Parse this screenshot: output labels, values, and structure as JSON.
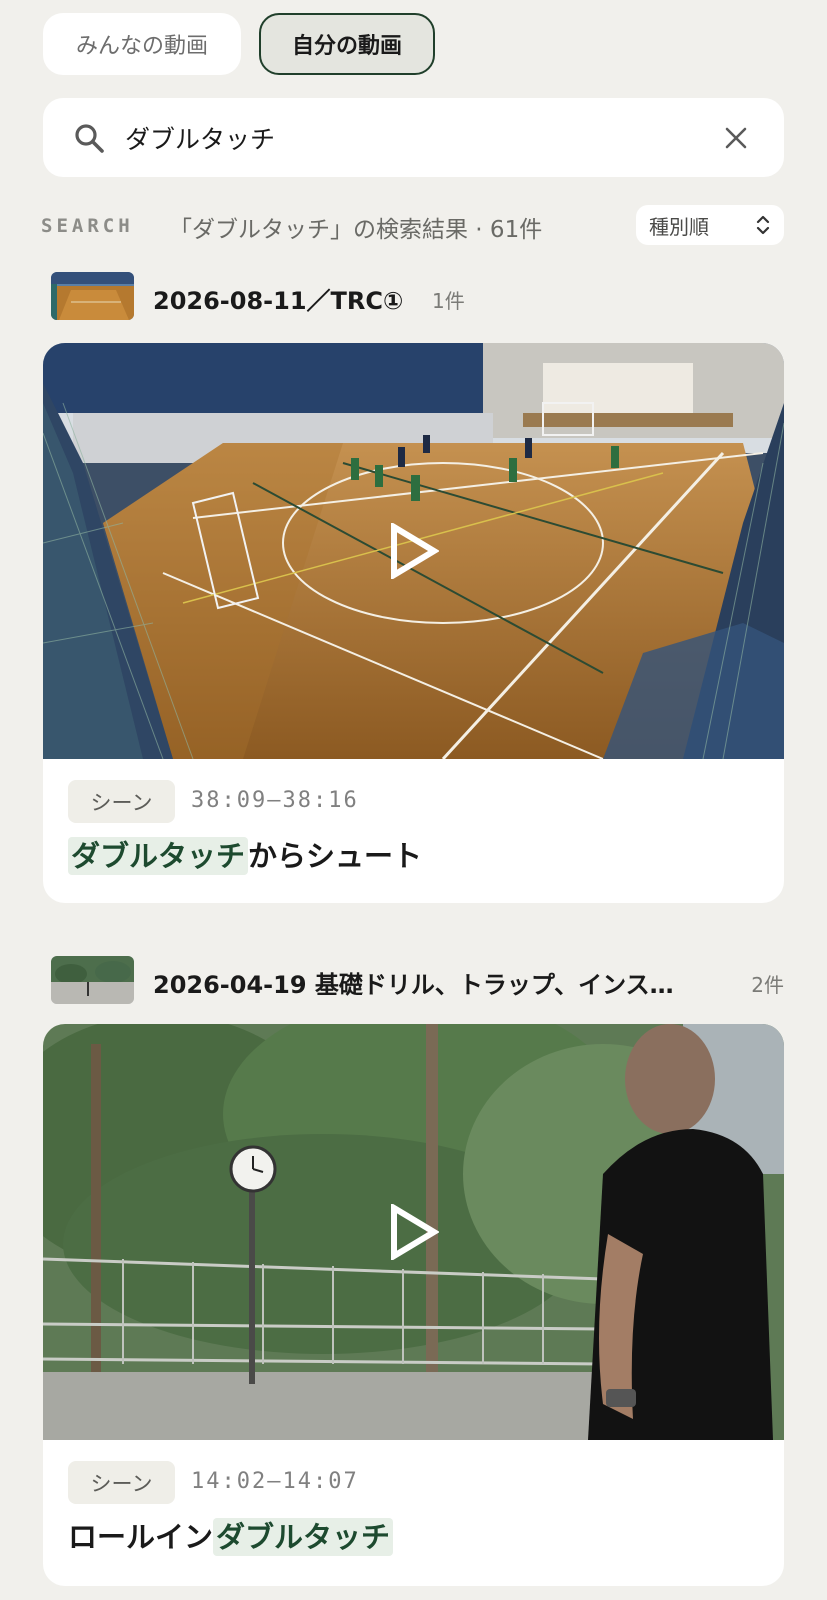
{
  "tabs": [
    {
      "label": "みんなの動画",
      "active": false
    },
    {
      "label": "自分の動画",
      "active": true
    }
  ],
  "search": {
    "value": "ダブルタッチ",
    "icon": "search-icon",
    "clear_icon": "close-icon"
  },
  "results": {
    "label": "SEARCH",
    "summary": "「ダブルタッチ」の検索結果 · 61件",
    "sort_label": "種別順",
    "sort_icon": "up-down-chevron-icon"
  },
  "groups": [
    {
      "title": "2026-08-11／TRC①",
      "count": "1件",
      "scenes": [
        {
          "badge": "シーン",
          "time": "38:09–38:16",
          "title_highlight": "ダブルタッチ",
          "title_rest": "からシュート",
          "play_icon": "play-icon"
        }
      ]
    },
    {
      "title": "2026-04-19 基礎ドリル、トラップ、インス…",
      "count": "2件",
      "scenes": [
        {
          "badge": "シーン",
          "time": "14:02–14:07",
          "title_prefix": "ロールイン",
          "title_highlight": "ダブルタッチ",
          "play_icon": "play-icon"
        }
      ]
    }
  ],
  "colors": {
    "background": "#f1f0ec",
    "accent": "#203f2b",
    "highlight_bg": "#e7efe7",
    "highlight_text": "#1d4a2f"
  }
}
